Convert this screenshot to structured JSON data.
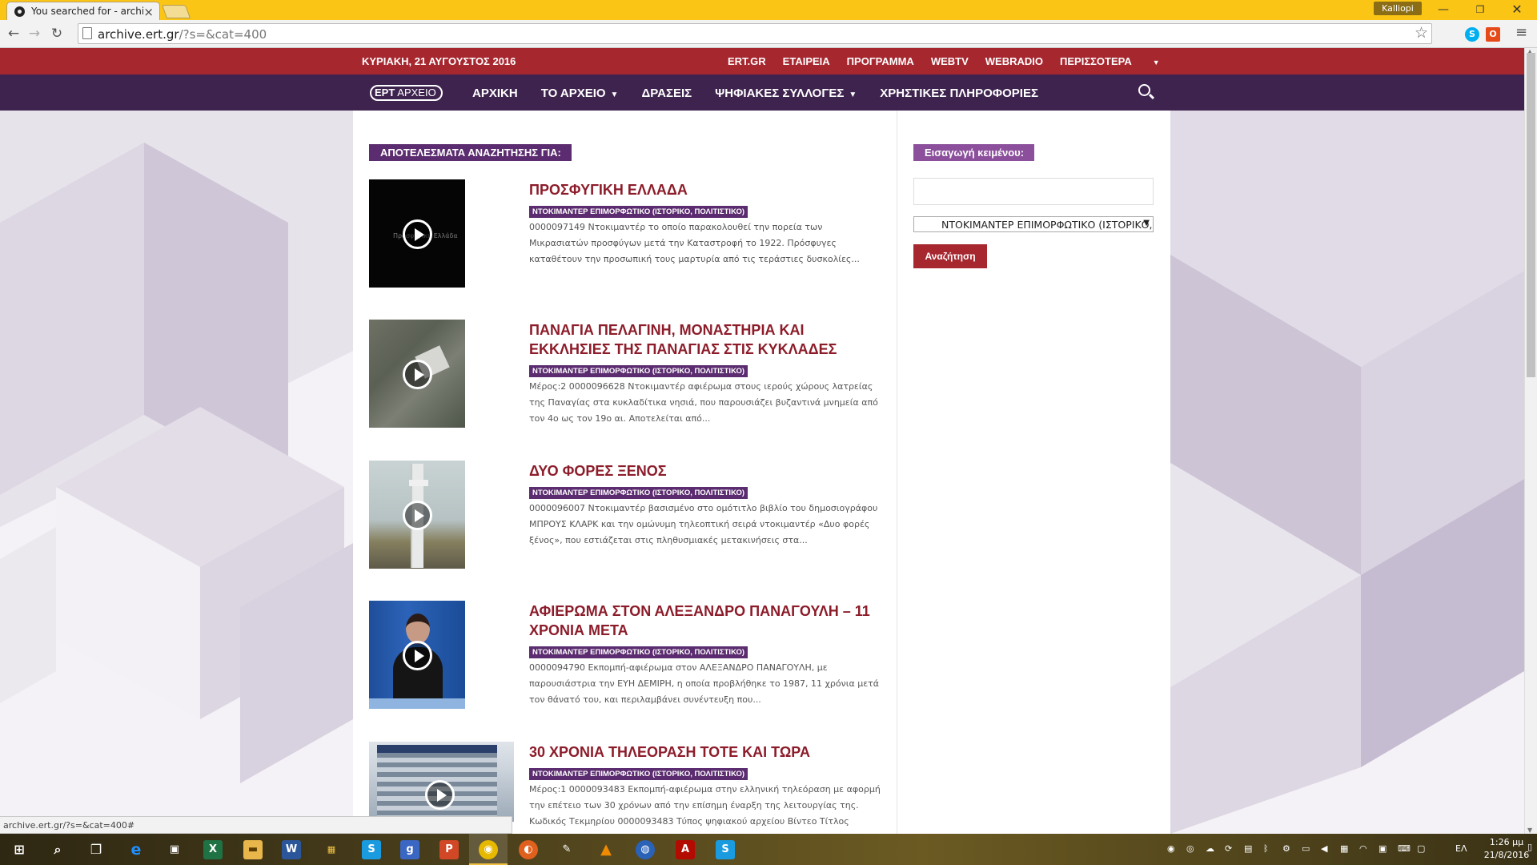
{
  "browser": {
    "tab_title": "You searched for - archive",
    "url_host": "archive.ert.gr",
    "url_path": "/?s=&cat=400",
    "user": "Kalliopi",
    "status_url": "archive.ert.gr/?s=&cat=400#"
  },
  "topbar": {
    "date": "ΚΥΡΙΑΚΗ, 21 ΑΥΓΟΥΣΤΟΣ 2016",
    "links": [
      "ERT.GR",
      "ΕΤΑΙΡΕΙΑ",
      "ΠΡΟΓΡΑΜΜΑ",
      "WEBTV",
      "WEBRADIO",
      "ΠΕΡΙΣΣΟΤΕΡΑ"
    ]
  },
  "nav": {
    "logo_a": "ΕΡΤ",
    "logo_b": "ΑΡΧΕΙΟ",
    "items": [
      "ΑΡΧΙΚΗ",
      "ΤΟ ΑΡΧΕΙΟ",
      "ΔΡΑΣΕΙΣ",
      "ΨΗΦΙΑΚΕΣ ΣΥΛΛΟΓΕΣ",
      "ΧΡΗΣΤΙΚΕΣ ΠΛΗΡΟΦΟΡΙΕΣ"
    ]
  },
  "results": {
    "heading": "ΑΠΟΤΕΛΕΣΜΑΤΑ ΑΝΑΖΗΤΗΣΗΣ ΓΙΑ:",
    "items": [
      {
        "title": "ΠΡΟΣΦΥΓΙΚΗ ΕΛΛΑΔΑ",
        "category": "ΝΤΟΚΙΜΑΝΤΕΡ ΕΠΙΜΟΡΦΩΤΙΚΟ (ΙΣΤΟΡΙΚΟ, ΠΟΛΙΤΙΣΤΙΚΟ)",
        "description": "0000097149 Ντοκιμαντέρ το οποίο παρακολουθεί την πορεία των Μικρασιατών προσφύγων μετά την Καταστροφή το 1922. Πρόσφυγες καταθέτουν την προσωπική τους μαρτυρία από τις τεράστιες δυσκολίες...",
        "thumb_caption": "Προσφυγική Ελλάδα"
      },
      {
        "title": "ΠΑΝΑΓΙΑ ΠΕΛΑΓΙΝΗ, ΜΟΝΑΣΤΗΡΙΑ ΚΑΙ ΕΚΚΛΗΣΙΕΣ ΤΗΣ ΠΑΝΑΓΙΑΣ ΣΤΙΣ ΚΥΚΛΑΔΕΣ",
        "category": "ΝΤΟΚΙΜΑΝΤΕΡ ΕΠΙΜΟΡΦΩΤΙΚΟ (ΙΣΤΟΡΙΚΟ, ΠΟΛΙΤΙΣΤΙΚΟ)",
        "description": " Μέρος:2 0000096628 Ντοκιμαντέρ αφιέρωμα στους ιερούς χώρους λατρείας της Παναγίας στα κυκλαδίτικα νησιά, που παρουσιάζει βυζαντινά μνημεία από τον 4ο ως τον 19ο αι. Αποτελείται από..."
      },
      {
        "title": "ΔΥΟ ΦΟΡΕΣ ΞΕΝΟΣ",
        "category": "ΝΤΟΚΙΜΑΝΤΕΡ ΕΠΙΜΟΡΦΩΤΙΚΟ (ΙΣΤΟΡΙΚΟ, ΠΟΛΙΤΙΣΤΙΚΟ)",
        "description": "0000096007 Ντοκιμαντέρ βασισμένο στο ομότιτλο βιβλίο του δημοσιογράφου ΜΠΡΟΥΣ ΚΛΑΡΚ και την ομώνυμη τηλεοπτική σειρά ντοκιμαντέρ «Δυο φορές ξένος», που εστιάζεται στις πληθυσμιακές μετακινήσεις στα..."
      },
      {
        "title": "ΑΦΙΕΡΩΜΑ ΣΤΟΝ ΑΛΕΞΑΝΔΡΟ ΠΑΝΑΓΟΥΛΗ – 11 ΧΡΟΝΙΑ ΜΕΤΑ",
        "category": "ΝΤΟΚΙΜΑΝΤΕΡ ΕΠΙΜΟΡΦΩΤΙΚΟ (ΙΣΤΟΡΙΚΟ, ΠΟΛΙΤΙΣΤΙΚΟ)",
        "description": "0000094790 Εκπομπή-αφιέρωμα στον ΑΛΕΞΑΝΔΡΟ ΠΑΝΑΓΟΥΛΗ, με παρουσιάστρια την ΕΥΗ ΔΕΜΙΡΗ, η οποία προβλήθηκε το 1987, 11 χρόνια μετά τον θάνατό του, και περιλαμβάνει συνέντευξη που..."
      },
      {
        "title": "30 ΧΡΟΝΙΑ ΤΗΛΕΟΡΑΣΗ ΤΟΤΕ ΚΑΙ ΤΩΡΑ",
        "category": "ΝΤΟΚΙΜΑΝΤΕΡ ΕΠΙΜΟΡΦΩΤΙΚΟ (ΙΣΤΟΡΙΚΟ, ΠΟΛΙΤΙΣΤΙΚΟ)",
        "description": "Μέρος:1 0000093483 Εκπομπή-αφιέρωμα στην ελληνική τηλεόραση με αφορμή την επέτειο των 30 χρόνων από την επίσημη έναρξη της λειτουργίας της. Κωδικός Τεκμηρίου 0000093483 Τύπος ψηφιακού αρχείου Βίντεο Τίτλος"
      }
    ]
  },
  "sidebar": {
    "heading": "Εισαγωγή κειμένου:",
    "input_value": "",
    "select_value": "ΝΤΟΚΙΜΑΝΤΕΡ ΕΠΙΜΟΡΦΩΤΙΚΟ (ΙΣΤΟΡΙΚΟ, ΠΟΛΙΤΙΣΤΙΚΟ)",
    "button": "Αναζήτηση"
  },
  "taskbar": {
    "language": "ΕΛ",
    "time": "1:26 μμ",
    "date": "21/8/2016"
  },
  "colors": {
    "topbar": "#a7272f",
    "nav": "#3e234f",
    "badge": "#5b2c6f",
    "title": "#8c1c2a"
  }
}
